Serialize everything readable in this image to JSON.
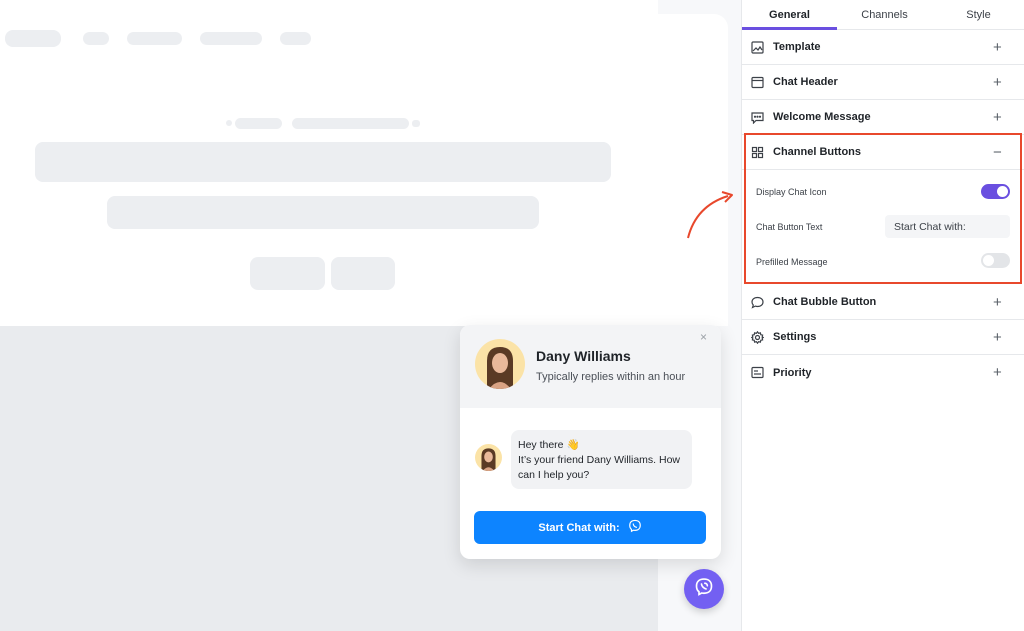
{
  "tabs": [
    {
      "label": "General",
      "active": true
    },
    {
      "label": "Channels",
      "active": false
    },
    {
      "label": "Style",
      "active": false
    }
  ],
  "sections": {
    "template": {
      "label": "Template",
      "toggle": "+"
    },
    "chat_header": {
      "label": "Chat Header",
      "toggle": "+"
    },
    "welcome_message": {
      "label": "Welcome Message",
      "toggle": "+"
    },
    "channel_buttons": {
      "label": "Channel Buttons",
      "toggle": "−"
    },
    "chat_bubble_button": {
      "label": "Chat Bubble Button",
      "toggle": "+"
    },
    "settings": {
      "label": "Settings",
      "toggle": "+"
    },
    "priority": {
      "label": "Priority",
      "toggle": "+"
    }
  },
  "channel_buttons": {
    "display_chat_icon": {
      "label": "Display Chat Icon",
      "on": true
    },
    "chat_button_text": {
      "label": "Chat Button Text",
      "value": "Start Chat with:"
    },
    "prefilled_message": {
      "label": "Prefilled Message",
      "on": false
    }
  },
  "widget": {
    "agent_name": "Dany Williams",
    "agent_status": "Typically replies within an hour",
    "close_glyph": "×",
    "message_line1": "Hey there 👋",
    "message_line2": "It’s your friend Dany Williams. How can I help you?",
    "button_label": "Start Chat with:"
  },
  "colors": {
    "accent": "#6a4fe0",
    "toggle_on": "#6a4fe0",
    "toggle_off": "#e3e5e8",
    "chat_button": "#0d84ff",
    "viber": "#7360f2",
    "highlight": "#e8482c"
  },
  "icons": {
    "template": "image-icon",
    "chat_header": "window-icon",
    "welcome_message": "message-icon",
    "channel_buttons": "grid-icon",
    "chat_bubble_button": "speech-bubble-icon",
    "settings": "gear-icon",
    "priority": "priority-icon",
    "chat_button": "viber-icon",
    "fab": "viber-icon"
  }
}
